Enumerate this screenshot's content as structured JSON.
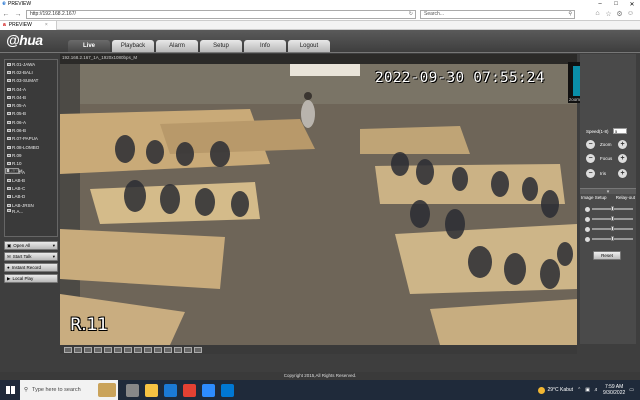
{
  "browser": {
    "window_title": "PREVIEW",
    "address": "http://192.168.2.167/",
    "search_placeholder": "Search...",
    "tab_label": "PREVIEW"
  },
  "app": {
    "brand": "alhua",
    "menu": [
      "Live",
      "Playback",
      "Alarm",
      "Setup",
      "Info",
      "Logout"
    ],
    "active_menu": "Live",
    "channels": [
      "R.01-JAWA",
      "R.02-BALI",
      "R.03-SUMAT",
      "R.04-A",
      "R.04-B",
      "R.05-A",
      "R.05-B",
      "R.06-A",
      "R.06-B",
      "R.07-PAPUA",
      "R.08-LOMBO",
      "R.09",
      "R.10",
      "R.11",
      "LAB-A",
      "LAB-B",
      "LAB-C",
      "LAB-D",
      "LAB-JRSN",
      "R.A..."
    ],
    "selected_channel": "R.11",
    "selected_marker": "M",
    "left_buttons": [
      "Open All",
      "Start Talk",
      "Instant Record",
      "Local Play"
    ],
    "video": {
      "info": "192.168.2.167_1A_1920x1080bps_M",
      "timestamp": "2022-09-30 07:55:24",
      "channel_label": "R.11"
    },
    "zoom_overlay": {
      "initial": "Z",
      "label": "zoom baa04"
    },
    "ptz": {
      "speed_label": "Speed(1-8)",
      "speed_value": "5",
      "controls": [
        "Zoom",
        "Focus",
        "Iris"
      ]
    },
    "image_setup": {
      "title": "Image Setup",
      "relay_label": "Relay-out",
      "reset_label": "Reset",
      "levels": [
        0.5,
        0.5,
        0.5,
        0.5,
        0.45
      ]
    },
    "footer": "Copyright 2015,All Rights Reserved."
  },
  "taskbar": {
    "search_placeholder": "Type here to search",
    "weather": "29°C  Kabut",
    "time": "7:59 AM",
    "date": "9/30/2022"
  },
  "colors": {
    "app_bg": "#4d4d4d",
    "accent_zoom": "#0a8ea8",
    "taskbar": "#1f2a3a"
  }
}
